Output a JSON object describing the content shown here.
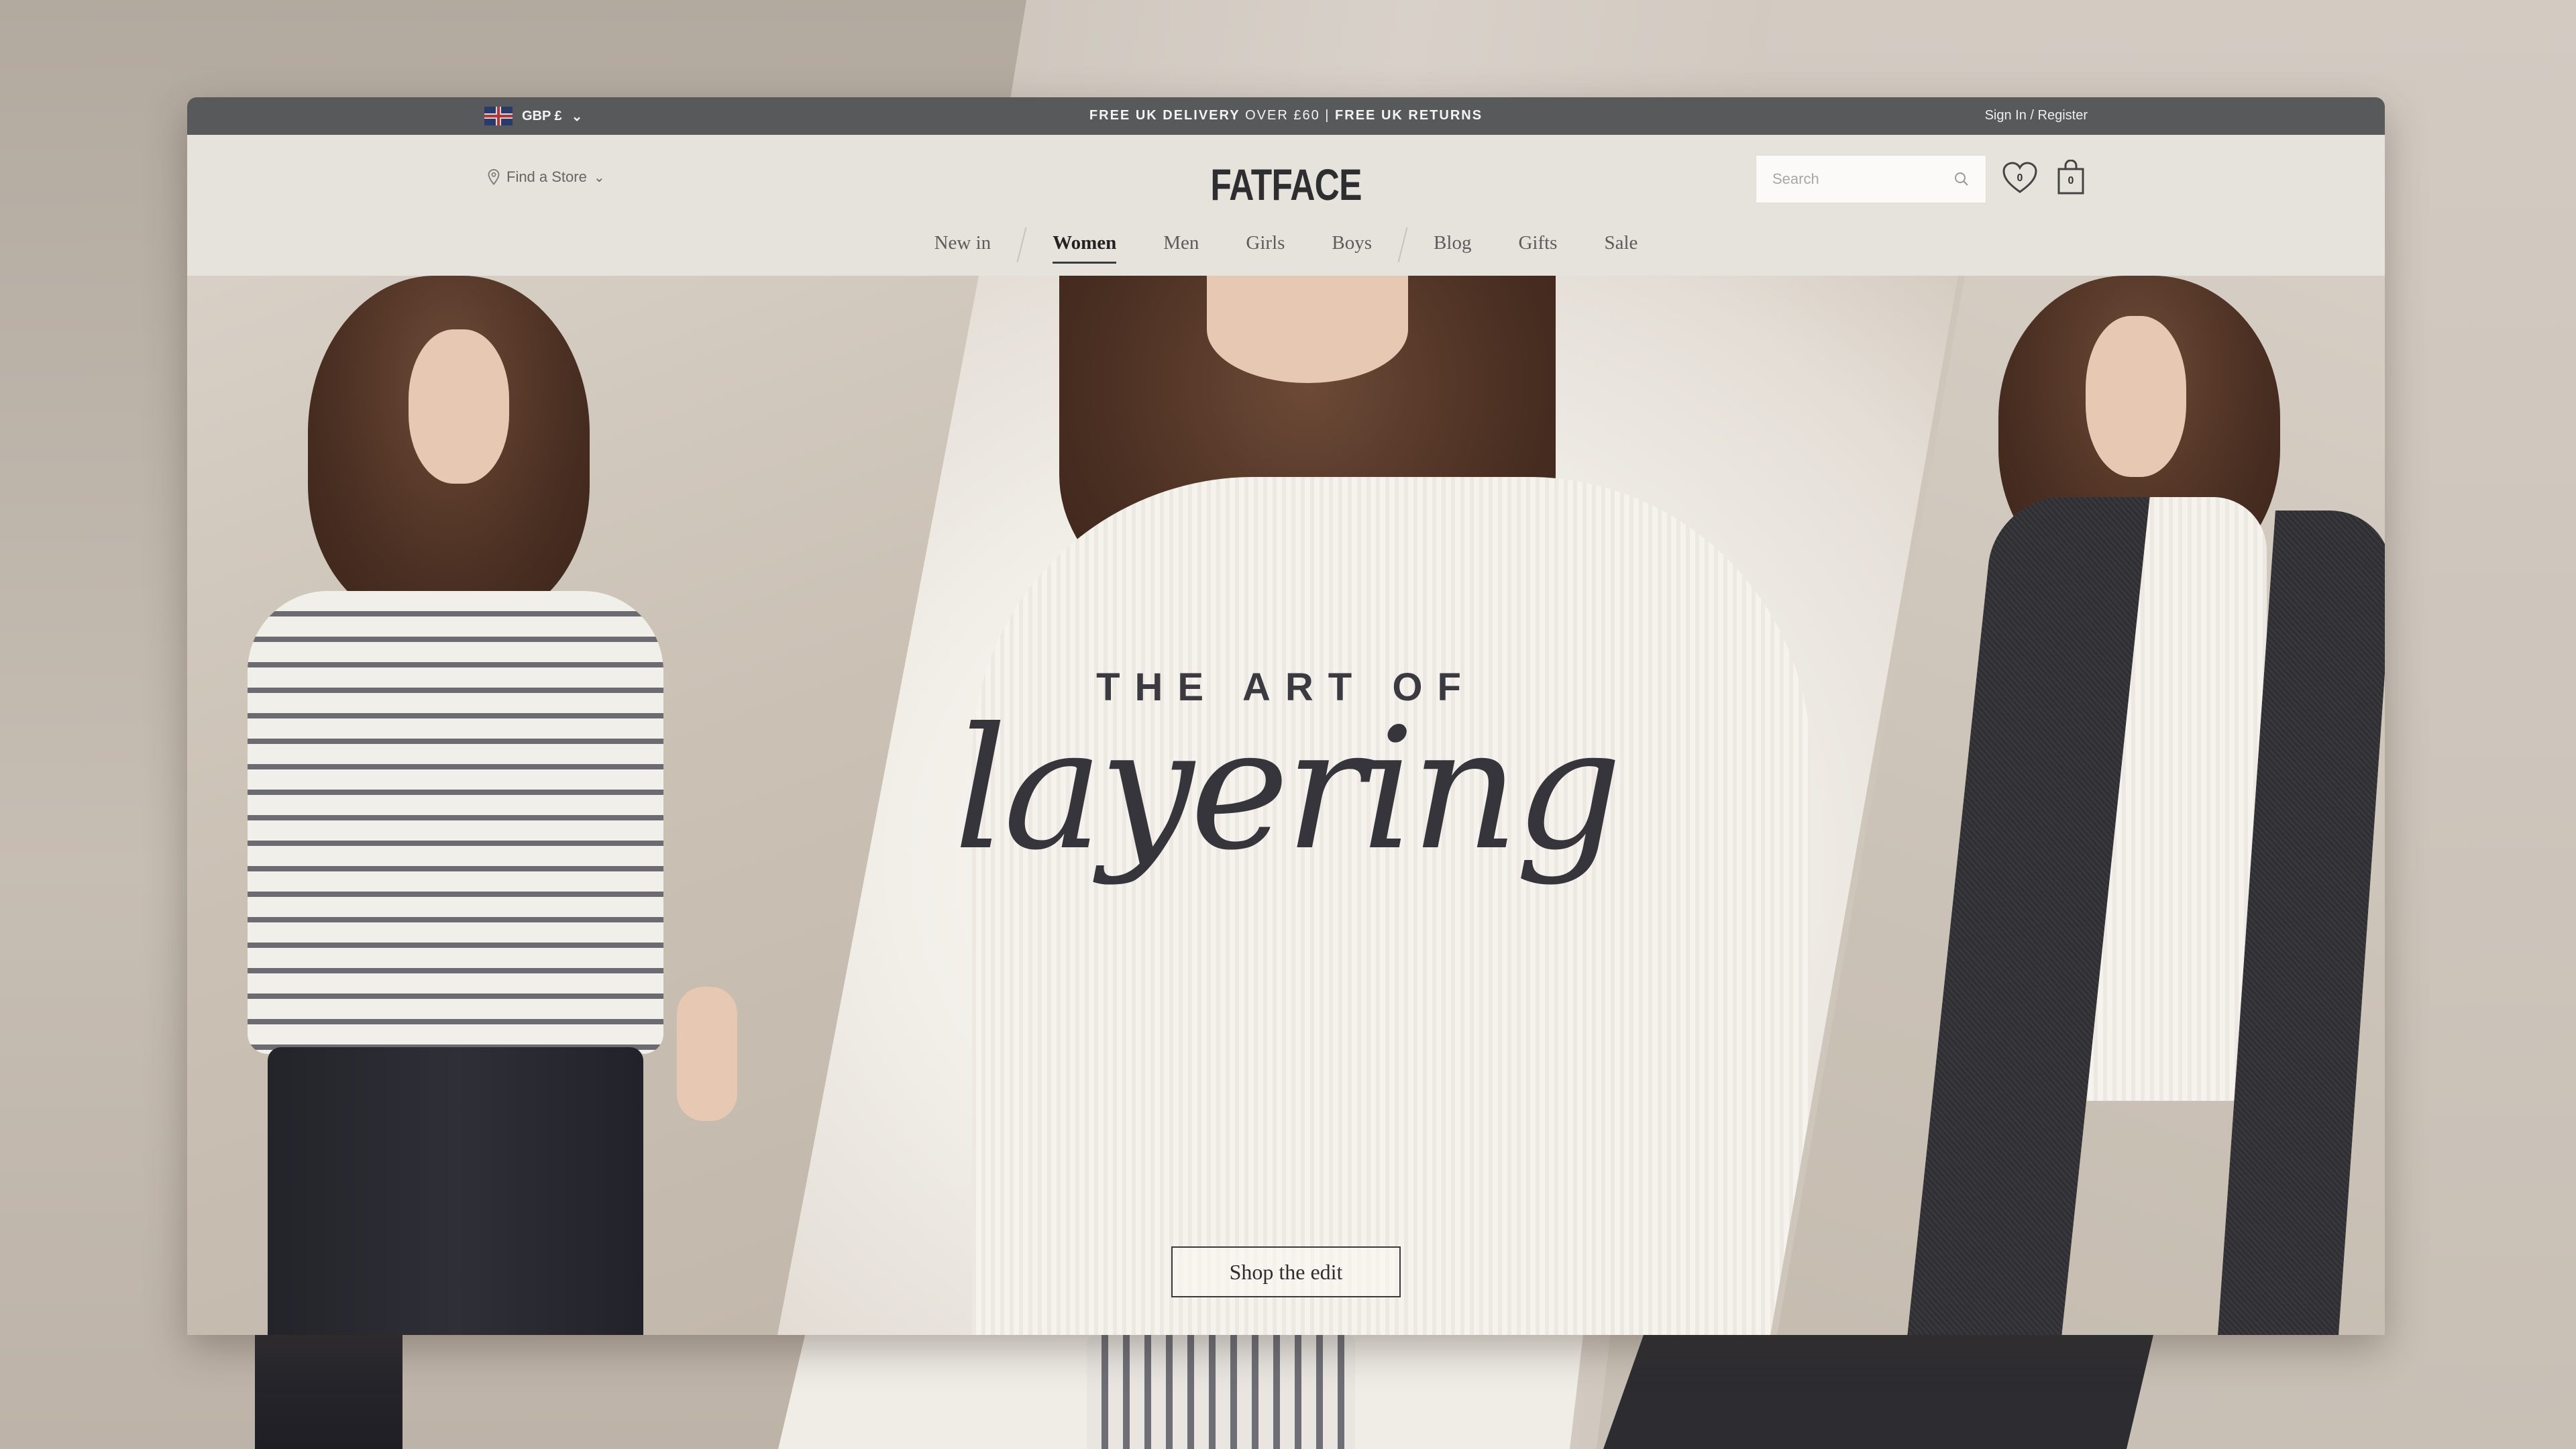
{
  "topbar": {
    "currency": "GBP £",
    "promo_delivery": "FREE UK DELIVERY",
    "promo_over": "OVER £60",
    "promo_sep": "|",
    "promo_returns": "FREE UK RETURNS",
    "account": "Sign In / Register"
  },
  "header": {
    "find_store": "Find a Store",
    "logo": "FATFACE",
    "search_placeholder": "Search",
    "wishlist_count": "0",
    "bag_count": "0"
  },
  "nav": {
    "items": [
      "New in",
      "Women",
      "Men",
      "Girls",
      "Boys",
      "Blog",
      "Gifts",
      "Sale"
    ],
    "active": "Women"
  },
  "hero": {
    "headline_top": "THE ART OF",
    "headline_script": "layering",
    "cta": "Shop the edit"
  },
  "colors": {
    "topbar_bg": "#58595b",
    "header_bg": "#e6e2dc",
    "text_dark": "#2e2e31"
  }
}
